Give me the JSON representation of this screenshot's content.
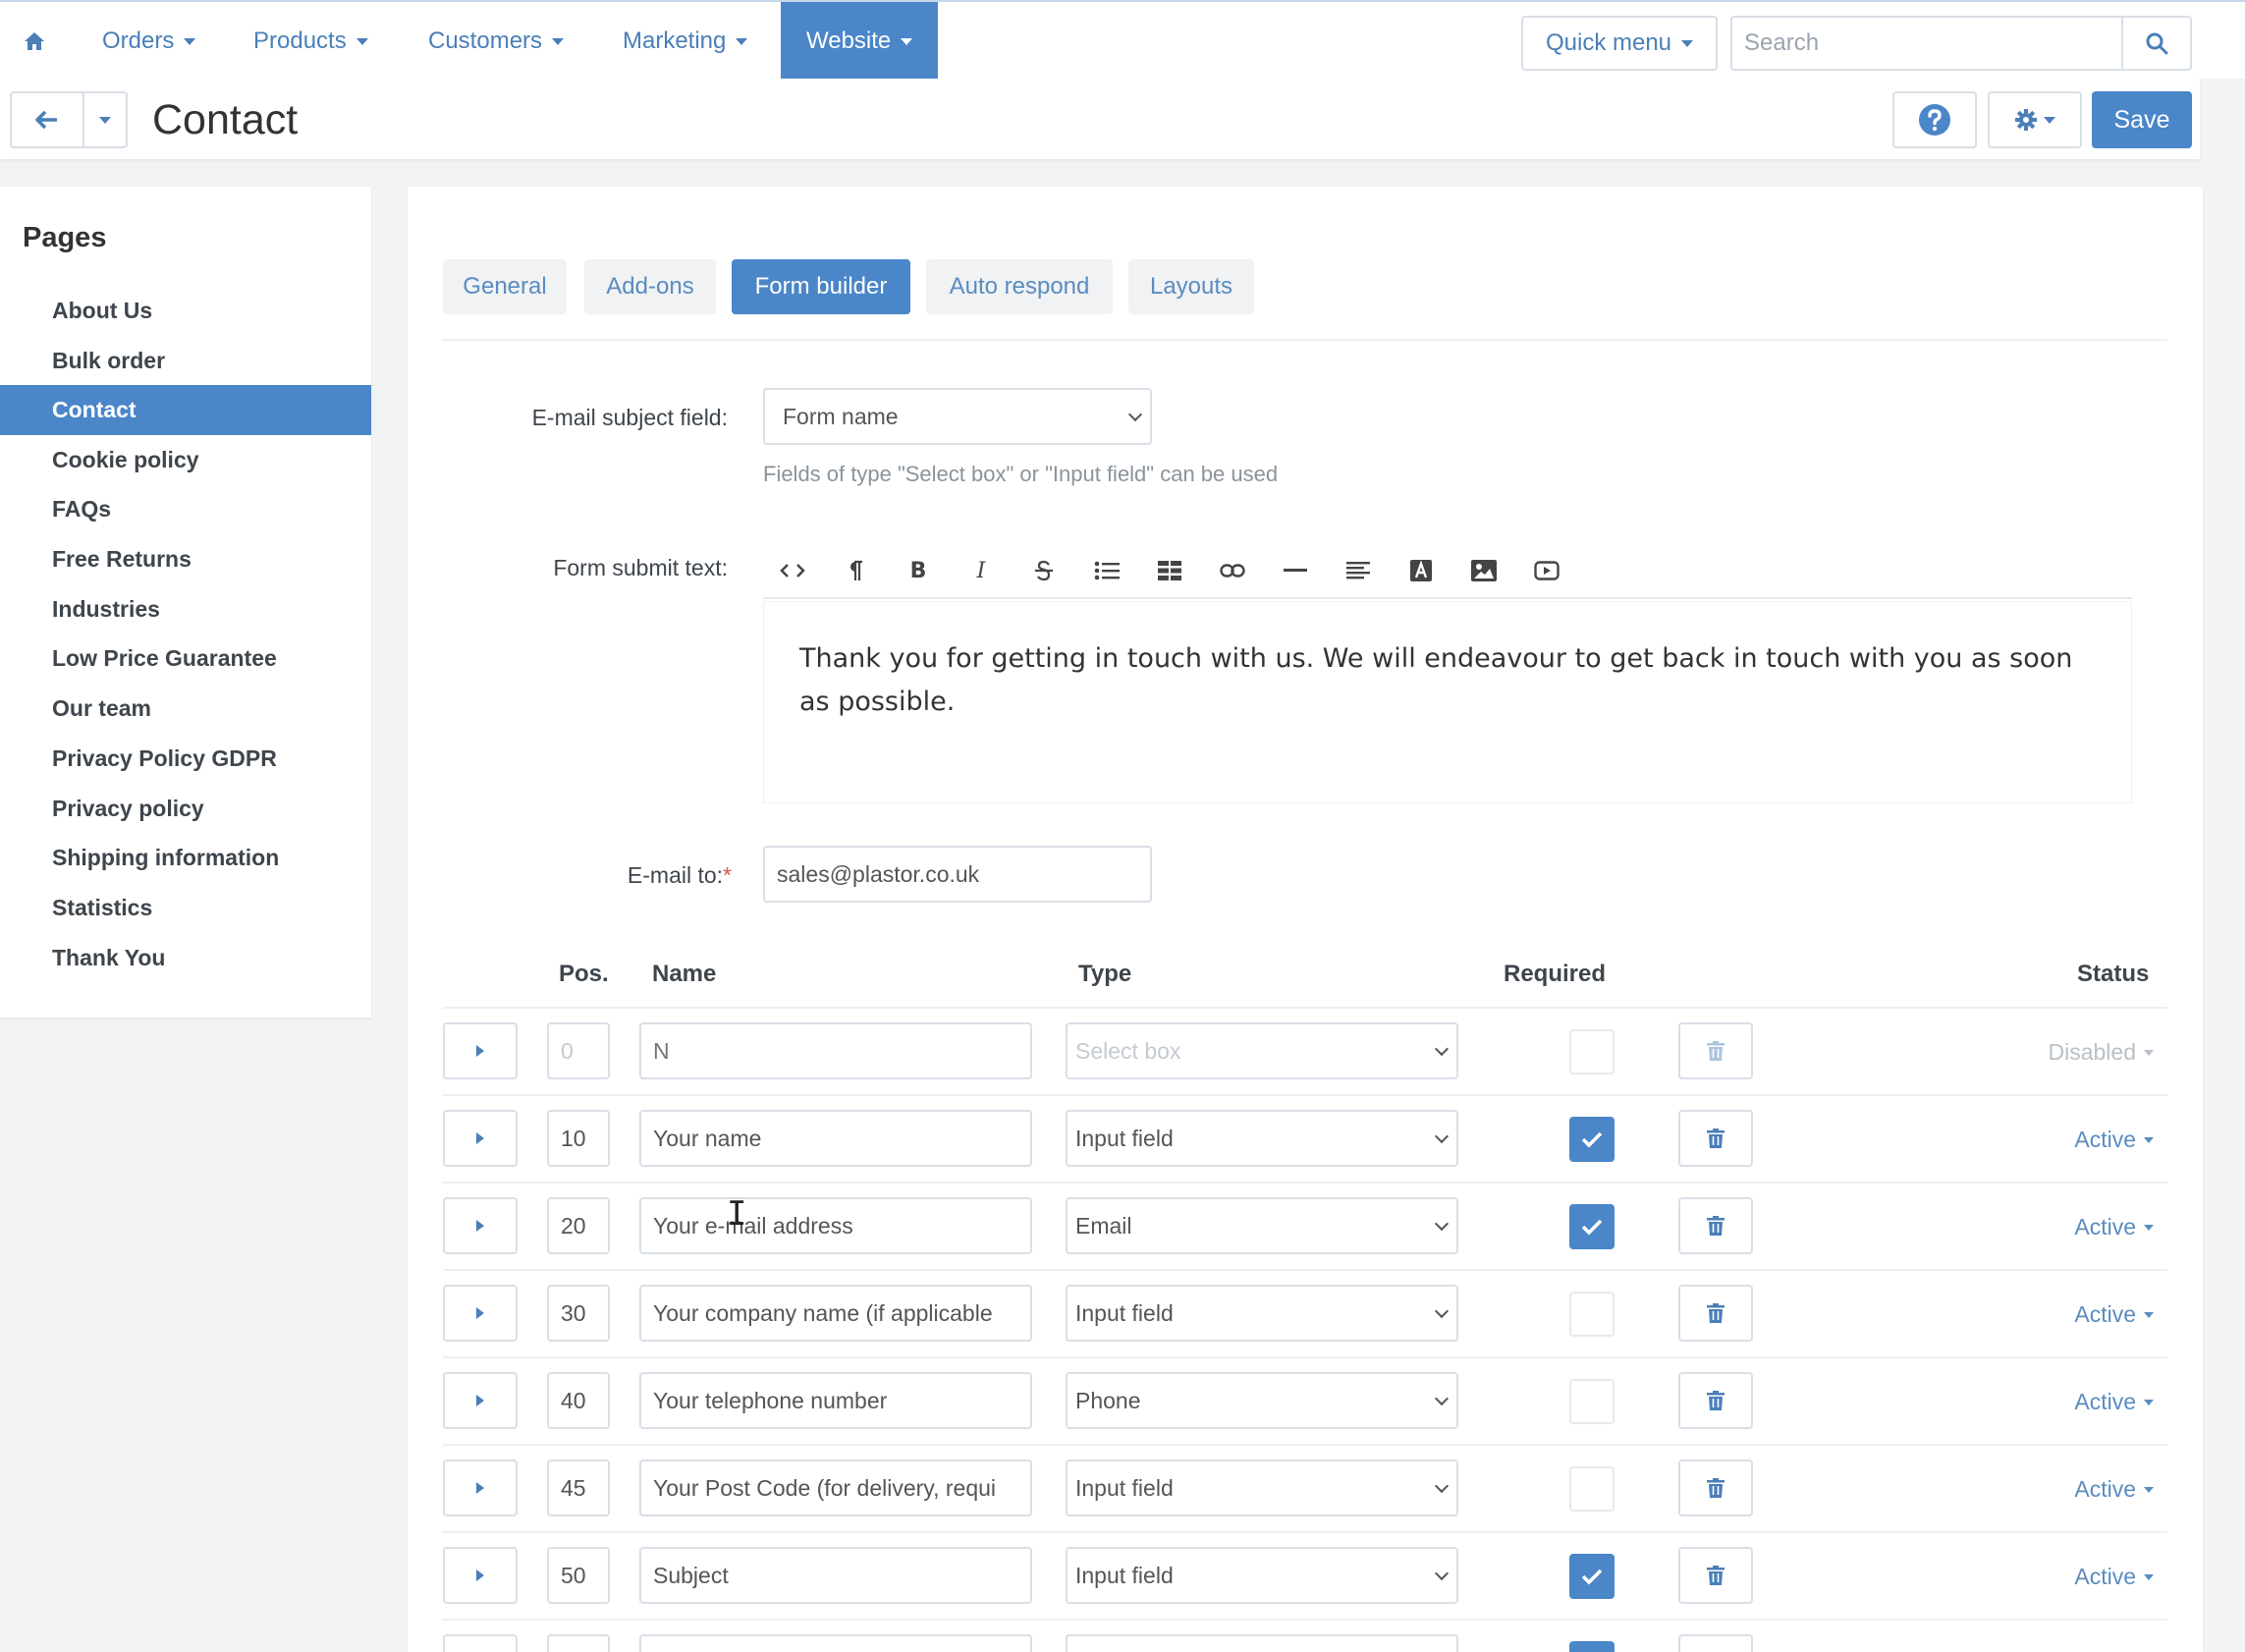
{
  "nav": {
    "home_icon": "home-icon",
    "items": [
      {
        "label": "Orders"
      },
      {
        "label": "Products"
      },
      {
        "label": "Customers"
      },
      {
        "label": "Marketing"
      },
      {
        "label": "Website"
      }
    ],
    "quick_menu_label": "Quick menu",
    "search_placeholder": "Search"
  },
  "header": {
    "title": "Contact",
    "save_label": "Save"
  },
  "sidebar": {
    "title": "Pages",
    "items": [
      {
        "label": "About Us"
      },
      {
        "label": "Bulk order"
      },
      {
        "label": "Contact"
      },
      {
        "label": "Cookie policy"
      },
      {
        "label": "FAQs"
      },
      {
        "label": "Free Returns"
      },
      {
        "label": "Industries"
      },
      {
        "label": "Low Price Guarantee"
      },
      {
        "label": "Our team"
      },
      {
        "label": "Privacy Policy GDPR"
      },
      {
        "label": "Privacy policy"
      },
      {
        "label": "Shipping information"
      },
      {
        "label": "Statistics"
      },
      {
        "label": "Thank You"
      }
    ],
    "active_item": "Contact"
  },
  "tabs": [
    {
      "label": "General"
    },
    {
      "label": "Add-ons"
    },
    {
      "label": "Form builder"
    },
    {
      "label": "Auto respond"
    },
    {
      "label": "Layouts"
    }
  ],
  "active_tab": "Form builder",
  "form": {
    "subject_label": "E-mail subject field:",
    "subject_value": "Form name",
    "subject_help": "Fields of type \"Select box\" or \"Input field\" can be used",
    "submit_text_label": "Form submit text:",
    "submit_text": "Thank you for getting in touch with us. We will endeavour to get back in touch with you as soon as possible.",
    "email_to_label": "E-mail to:",
    "email_to_required_mark": "*",
    "email_to_value": "sales@plastor.co.uk"
  },
  "table": {
    "headers": {
      "pos": "Pos.",
      "name": "Name",
      "type": "Type",
      "required": "Required",
      "status": "Status"
    },
    "rows": [
      {
        "pos": "0",
        "name": "",
        "name_placeholder": "N",
        "type": "Select box",
        "required": false,
        "status": "Disabled"
      },
      {
        "pos": "10",
        "name": "Your name",
        "type": "Input field",
        "required": true,
        "status": "Active"
      },
      {
        "pos": "20",
        "name": "Your e-mail address",
        "type": "Email",
        "required": true,
        "status": "Active"
      },
      {
        "pos": "30",
        "name": "Your company name (if applicable",
        "type": "Input field",
        "required": false,
        "status": "Active"
      },
      {
        "pos": "40",
        "name": "Your telephone number",
        "type": "Phone",
        "required": false,
        "status": "Active"
      },
      {
        "pos": "45",
        "name": "Your Post Code (for delivery, requi",
        "type": "Input field",
        "required": false,
        "status": "Active"
      },
      {
        "pos": "50",
        "name": "Subject",
        "type": "Input field",
        "required": true,
        "status": "Active"
      }
    ]
  },
  "colors": {
    "accent": "#4a86c8",
    "link": "#5a8cc0"
  }
}
